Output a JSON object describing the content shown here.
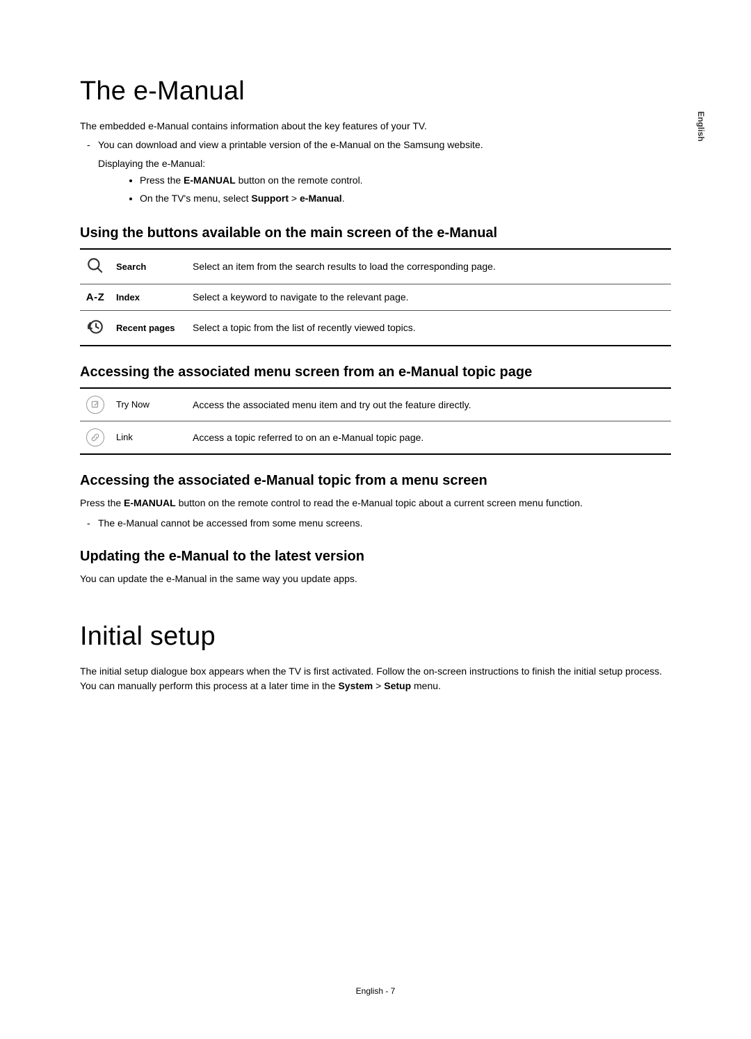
{
  "sideLang": "English",
  "h1_emanual": "The e-Manual",
  "intro": "The embedded e-Manual contains information about the key features of your TV.",
  "dash1_a": "You can download and view a printable version of the e-Manual on the Samsung website.",
  "dash1_b": "Displaying the e-Manual:",
  "bullet1_pre": "Press the ",
  "bullet1_bold": "E-MANUAL",
  "bullet1_post": " button on the remote control.",
  "bullet2_pre": "On the TV's menu, select ",
  "bullet2_b1": "Support",
  "bullet2_mid": " > ",
  "bullet2_b2": "e-Manual",
  "bullet2_post": ".",
  "sec1_title": "Using the buttons available on the main screen of the e-Manual",
  "t1r1_label": "Search",
  "t1r1_desc": "Select an item from the search results to load the corresponding page.",
  "t1r2_icon": "A-Z",
  "t1r2_label": "Index",
  "t1r2_desc": "Select a keyword to navigate to the relevant page.",
  "t1r3_label": "Recent pages",
  "t1r3_desc": "Select a topic from the list of recently viewed topics.",
  "sec2_title": "Accessing the associated menu screen from an e-Manual topic page",
  "t2r1_label": "Try Now",
  "t2r1_desc": "Access the associated menu item and try out the feature directly.",
  "t2r2_label": "Link",
  "t2r2_desc": "Access a topic referred to on an e-Manual topic page.",
  "sec3_title": "Accessing the associated e-Manual topic from a menu screen",
  "sec3_p_pre": "Press the ",
  "sec3_p_bold": "E-MANUAL",
  "sec3_p_post": " button on the remote control to read the e-Manual topic about a current screen menu function.",
  "sec3_dash": "The e-Manual cannot be accessed from some menu screens.",
  "sec4_title": "Updating the e-Manual to the latest version",
  "sec4_p": "You can update the e-Manual in the same way you update apps.",
  "h1_initial": "Initial setup",
  "initial_p_pre": "The initial setup dialogue box appears when the TV is first activated. Follow the on-screen instructions to finish the initial setup process. You can manually perform this process at a later time in the ",
  "initial_b1": "System",
  "initial_mid": " > ",
  "initial_b2": "Setup",
  "initial_post": " menu.",
  "footer": "English - 7"
}
